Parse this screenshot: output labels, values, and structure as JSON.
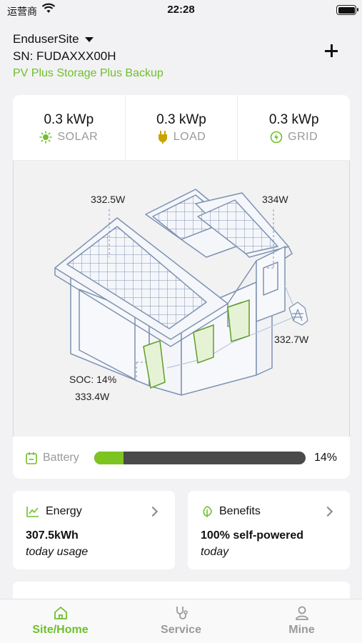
{
  "status_bar": {
    "carrier": "运营商",
    "time": "22:28"
  },
  "site": {
    "name": "EnduserSite",
    "sn": "SN: FUDAXXX00H",
    "mode": "PV Plus Storage Plus Backup"
  },
  "stats": [
    {
      "value": "0.3 kWp",
      "label": "SOLAR",
      "icon": "sun-icon"
    },
    {
      "value": "0.3 kWp",
      "label": "LOAD",
      "icon": "plug-icon"
    },
    {
      "value": "0.3 kWp",
      "label": "GRID",
      "icon": "lightning-icon"
    }
  ],
  "flows": {
    "solar_left": "332.5W",
    "solar_right": "334W",
    "grid": "332.7W",
    "soc": "SOC: 14%",
    "battery_power": "333.4W"
  },
  "battery": {
    "label": "Battery",
    "percent_text": "14%",
    "level": 0.14
  },
  "cards": {
    "energy": {
      "title": "Energy",
      "value": "307.5kWh",
      "sub": "today usage"
    },
    "benefits": {
      "title": "Benefits",
      "value": "100% self-powered",
      "sub": "today"
    }
  },
  "tabs": [
    {
      "label": "Site/Home",
      "icon": "home-icon",
      "active": true
    },
    {
      "label": "Service",
      "icon": "stethoscope-icon",
      "active": false
    },
    {
      "label": "Mine",
      "icon": "user-icon",
      "active": false
    }
  ],
  "colors": {
    "accent": "#6fbf2c",
    "inactive_tab": "#9a9a9a",
    "battery_track": "#4a4a4a"
  }
}
